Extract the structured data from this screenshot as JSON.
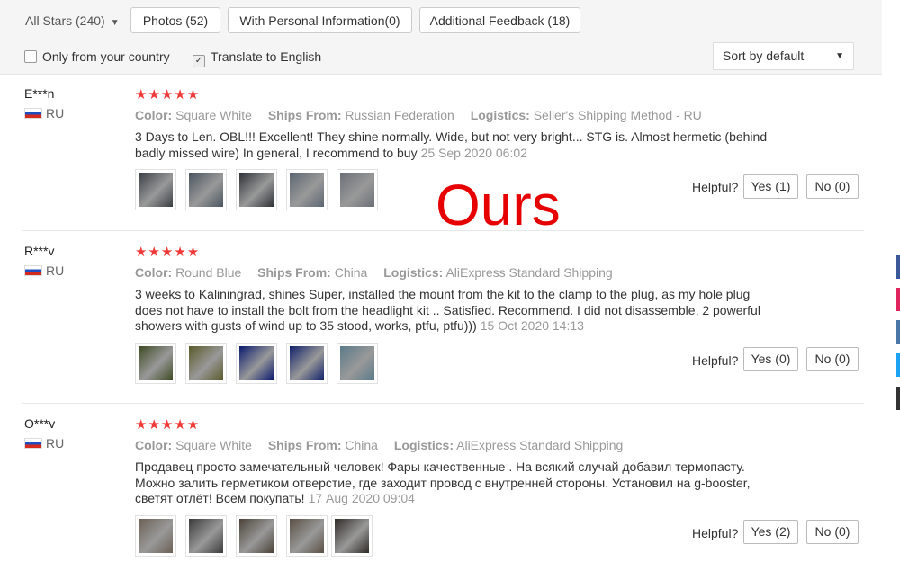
{
  "filters": {
    "all_stars": "All Stars (240)",
    "tabs": [
      "Photos (52)",
      "With Personal Information(0)",
      "Additional Feedback (18)"
    ],
    "only_country": "Only from your country",
    "translate": "Translate to English",
    "sort": "Sort by default"
  },
  "overlay": "Ours",
  "labels": {
    "color": "Color:",
    "ships": "Ships From:",
    "logistics": "Logistics:",
    "helpful": "Helpful?"
  },
  "reviews": [
    {
      "user": "E***n",
      "country": "RU",
      "stars": "★★★★★",
      "color": "Square White",
      "ships": "Russian Federation",
      "logistics": "Seller's Shipping Method - RU",
      "text": "3 Days to Len. OBL!!! Excellent! They shine normally. Wide, but not very bright... STG is. Almost hermetic (behind badly missed wire) In general, I recommend to buy",
      "date": "25 Sep 2020 06:02",
      "yes": "Yes (1)",
      "no": "No (0)",
      "photos": [
        "#3a3f45",
        "#4b5560",
        "#2e3238",
        "#5c6672",
        "#6a6f75"
      ]
    },
    {
      "user": "R***v",
      "country": "RU",
      "stars": "★★★★★",
      "color": "Round Blue",
      "ships": "China",
      "logistics": "AliExpress Standard Shipping",
      "text": "3 weeks to Kaliningrad, shines Super, installed the mount from the kit to the clamp to the plug, as my hole plug does not have to install the bolt from the headlight kit .. Satisfied. Recommend. I did not disassemble, 2 powerful showers with gusts of wind up to 35 stood, works, ptfu, ptfu)))",
      "date": "15 Oct 2020 14:13",
      "yes": "Yes (0)",
      "no": "No (0)",
      "photos": [
        "#3d4a22",
        "#5a5a2a",
        "#0a1a6e",
        "#10206a",
        "#5a7a8a"
      ]
    },
    {
      "user": "O***v",
      "country": "RU",
      "stars": "★★★★★",
      "color": "Square White",
      "ships": "China",
      "logistics": "AliExpress Standard Shipping",
      "text": "Продавец просто замечательный человек! Фары качественные . На всякий случай добавил термопасту. Можно залить герметиком отверстие, где заходит провод с внутренней стороны. Установил на g-booster, светят отлёт! Всем покупать!",
      "date": "17 Aug 2020 09:04",
      "yes": "Yes (2)",
      "no": "No (0)",
      "photos": [
        "#6b6055",
        "#3a3a3a",
        "#4a4238",
        "#5a5045",
        "#2e2a26"
      ]
    }
  ],
  "accent_colors": {
    "star": "#f03a3a",
    "overlay": "#e60000"
  }
}
